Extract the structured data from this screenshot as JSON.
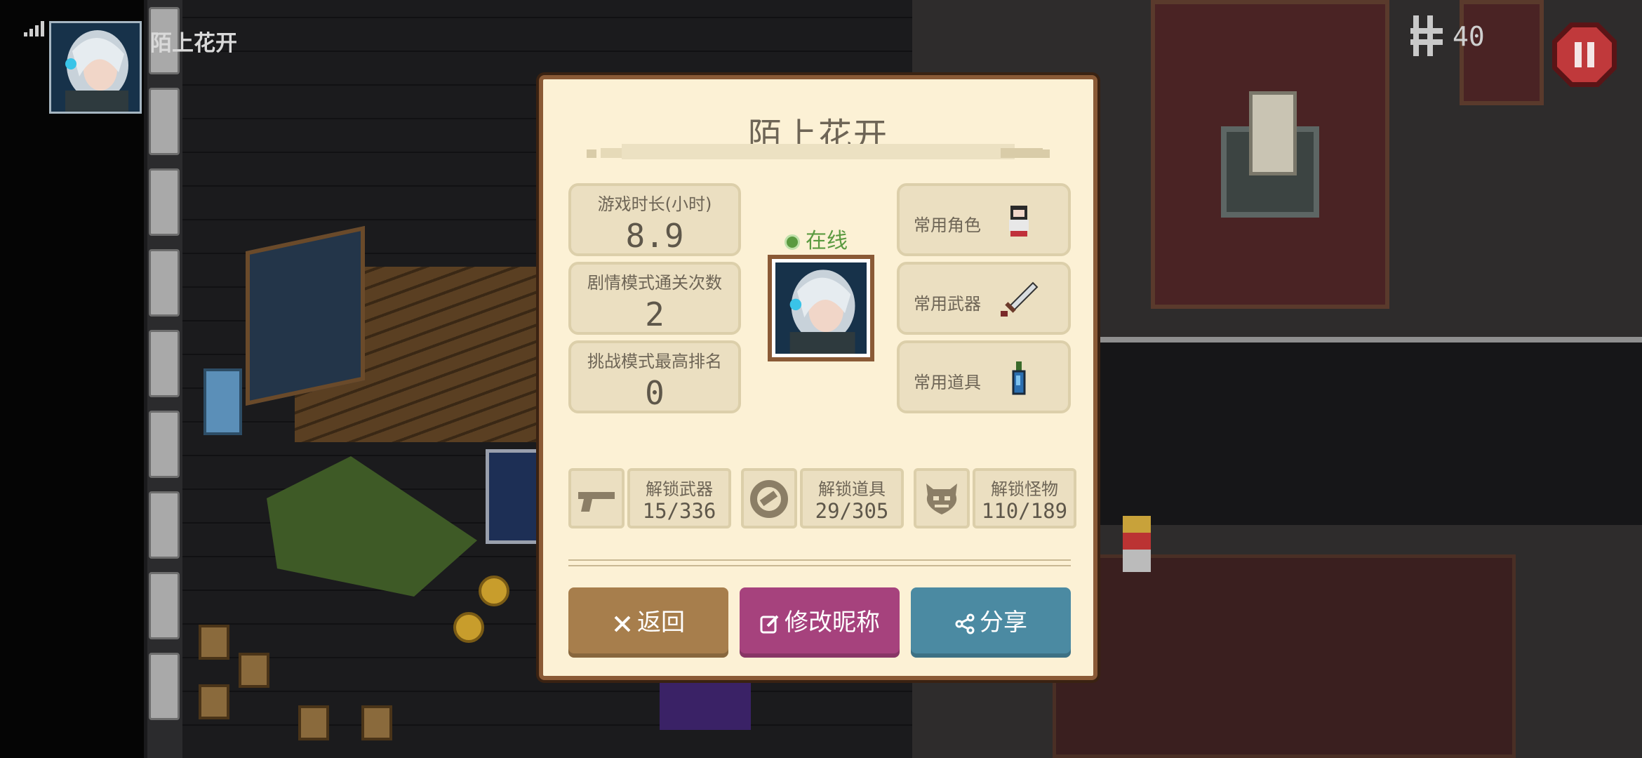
{
  "hud": {
    "player_name": "陌上花开",
    "gold": "40",
    "avatar": "player-portrait",
    "signal": "signal-icon",
    "pause": "pause-icon"
  },
  "dialog": {
    "title": "陌上花开",
    "online_status": "在线",
    "stats": [
      {
        "label": "游戏时长(小时)",
        "value": "8.9"
      },
      {
        "label": "剧情模式通关次数",
        "value": "2"
      },
      {
        "label": "挑战模式最高排名",
        "value": "0"
      }
    ],
    "favorites": [
      {
        "label": "常用角色",
        "icon": "character-icon"
      },
      {
        "label": "常用武器",
        "icon": "sword-icon"
      },
      {
        "label": "常用道具",
        "icon": "potion-icon"
      }
    ],
    "unlocks": [
      {
        "label": "解锁武器",
        "value": "15/336",
        "icon": "pistol-icon"
      },
      {
        "label": "解锁道具",
        "value": "29/305",
        "icon": "item-ring-icon"
      },
      {
        "label": "解锁怪物",
        "value": "110/189",
        "icon": "monster-icon"
      }
    ],
    "buttons": {
      "back": "返回",
      "rename": "修改昵称",
      "share": "分享"
    }
  },
  "colors": {
    "panel_bg": "#fcf1d5",
    "panel_border": "#8a5a36",
    "back_button": "#a77e4c",
    "rename_button": "#a6427d",
    "share_button": "#4b8aa2",
    "online": "#5a9a40"
  }
}
